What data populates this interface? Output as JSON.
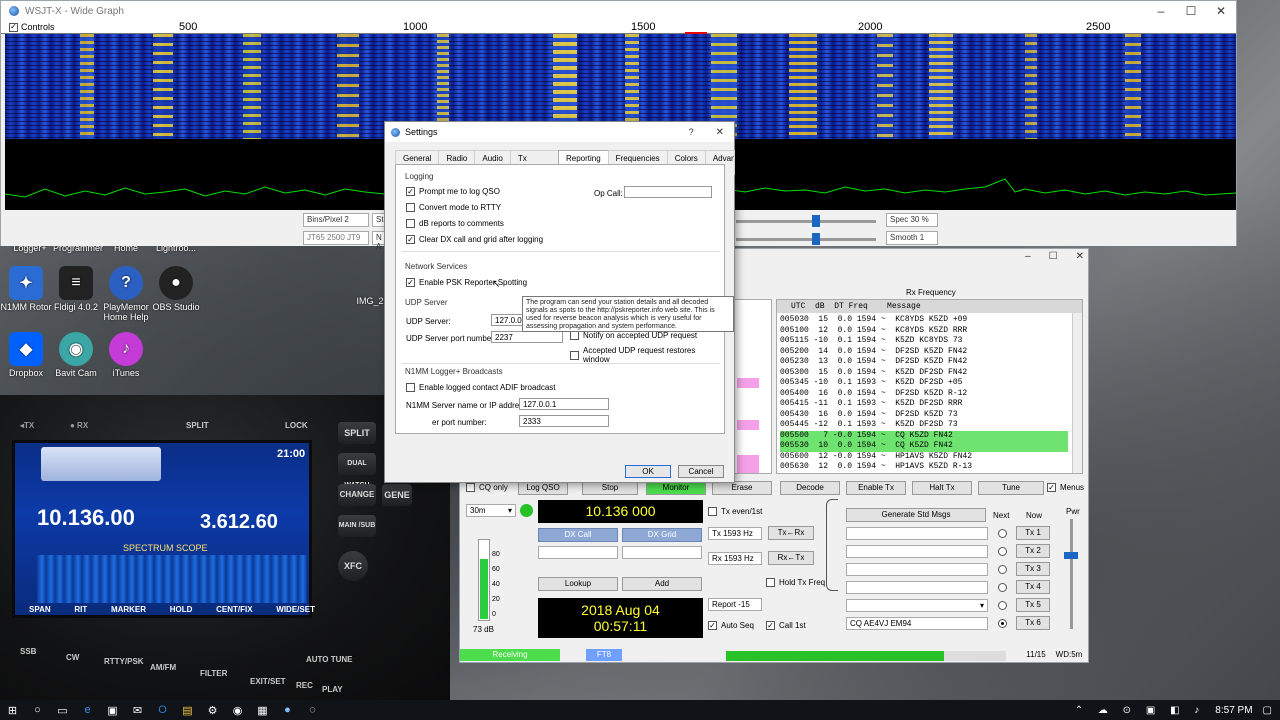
{
  "widegraph": {
    "title": "WSJT-X - Wide Graph",
    "controls_label": "Controls",
    "scale_labels": [
      "500",
      "1000",
      "1500",
      "2000",
      "2500"
    ],
    "bins_per_pixel": "Bins/Pixel  2",
    "start_label": "Sta",
    "mode_label": "JT65  2500  JT9",
    "n_avg_label": "N A",
    "spec_label": "Spec 30 %",
    "smooth_label": "Smooth  1"
  },
  "desktop": {
    "icons": [
      {
        "label": "Logger+",
        "glyph": "L",
        "color": "#3a6fb0"
      },
      {
        "label": "Programmer",
        "glyph": "P",
        "color": "#555"
      },
      {
        "label": "Home",
        "glyph": "H",
        "color": "#555"
      },
      {
        "label": "Lightroo...",
        "glyph": "Lr",
        "color": "#2c3b55"
      },
      {
        "label": "N1MM Rotor",
        "glyph": "N",
        "color": "#2b6cd4"
      },
      {
        "label": "Fldigi 4.0.2",
        "glyph": "F",
        "color": "#222"
      },
      {
        "label": "PlayMemor Home Help",
        "glyph": "?",
        "color": "#2b5fc2"
      },
      {
        "label": "OBS Studio",
        "glyph": "●",
        "color": "#222"
      },
      {
        "label": "Dropbox",
        "glyph": "◆",
        "color": "#0061ff"
      },
      {
        "label": "Bavit Cam",
        "glyph": "◉",
        "color": "#3aa6a6"
      },
      {
        "label": "iTunes",
        "glyph": "♪",
        "color": "#c43bd8"
      },
      {
        "label": "IMG_2",
        "glyph": "▣",
        "color": "#666"
      }
    ]
  },
  "settings": {
    "title": "Settings",
    "help": "?",
    "close": "✕",
    "tabs": [
      "General",
      "Radio",
      "Audio",
      "Tx Macros",
      "Reporting",
      "Frequencies",
      "Colors",
      "Advanced"
    ],
    "logging_label": "Logging",
    "prompt_log": "Prompt me to log QSO",
    "convert_rtty": "Convert mode to RTTY",
    "db_reports": "dB reports to comments",
    "clear_dx": "Clear DX call and grid after logging",
    "op_call_label": "Op Call:",
    "network_label": "Network Services",
    "psk_reporter": "Enable PSK Reporter Spotting",
    "udp_label": "UDP Server",
    "udp_server_label": "UDP Server:",
    "udp_server_value": "127.0.0.",
    "udp_port_label": "UDP Server port number:",
    "udp_port_value": "2237",
    "notify_udp": "Notify on accepted UDP request",
    "accepted_udp": "Accepted UDP request restores window",
    "n1mm_label": "N1MM Logger+ Broadcasts",
    "enable_adif": "Enable logged contact ADIF broadcast",
    "n1mm_server_label": "N1MM Server name or IP address:",
    "n1mm_server_value": "127.0.0.1",
    "n1mm_port_label": "er port number:",
    "n1mm_port_value": "2333",
    "tooltip": "The program can send your station details and all decoded signals as spots to the http://pskreporter.info web site. This is used for reverse beacon analysis which is very useful for assessing propagation and system performance.",
    "ok": "OK",
    "cancel": "Cancel"
  },
  "main": {
    "rx_frequency_title": "Rx Frequency",
    "decode_header": "UTC  dB  DT Freq    Message",
    "decodes": [
      "005030  15  0.0 1594 ~  KC8YDS K5ZD +09",
      "005100  12  0.0 1594 ~  KC8YDS K5ZD RRR",
      "005115 -10  0.1 1594 ~  K5ZD KC8YDS 73",
      "005200  14  0.0 1594 ~  DF2SD K5ZD FN42",
      "005230  13  0.0 1594 ~  DF2SD K5ZD FN42",
      "005300  15  0.0 1594 ~  K5ZD DF2SD FN42",
      "005345 -10  0.1 1593 ~  K5ZD DF2SD +05",
      "005400  16  0.0 1594 ~  DF2SD K5ZD R-12",
      "005415 -11  0.1 1593 ~  K5ZD DF2SD RRR",
      "005430  16  0.0 1594 ~  DF2SD K5ZD 73",
      "005445 -12  0.1 1593 ~  K5ZD DF2SD 73",
      "005500   7 -0.0 1594 ~  CQ K5ZD FN42",
      "005530  10  0.0 1594 ~  CQ K5ZD FN42",
      "005600  12 -0.0 1594 ~  HP1AVS K5ZD FN42",
      "005630  12  0.0 1594 ~  HP1AVS K5ZD R-13"
    ],
    "toolbar": [
      "CQ only",
      "Log QSO",
      "Stop",
      "Monitor",
      "Erase",
      "Decode",
      "Enable Tx",
      "Halt Tx",
      "Tune"
    ],
    "menus_label": "Menus",
    "band": "30m",
    "dial_freq": "10.136 000",
    "tx_even": "Tx even/1st",
    "dx_call": "DX Call",
    "dx_grid": "DX Grid",
    "tx_freq": "Tx  1593 Hz",
    "rx_freq": "Rx  1593 Hz",
    "tx_to_rx": "Tx←Rx",
    "rx_to_tx": "Rx←Tx",
    "lookup": "Lookup",
    "add": "Add",
    "hold_tx": "Hold Tx Freq",
    "date": "2018 Aug 04",
    "time": "00:57:11",
    "report": "Report -15",
    "auto_seq": "Auto Seq",
    "call_1st": "Call 1st",
    "db_level": "73 dB",
    "meter_ticks": [
      "80",
      "60",
      "40",
      "20",
      "0"
    ],
    "next_label": "Next",
    "now_label": "Now",
    "gen_std": "Generate Std Msgs",
    "pwr": "Pwr",
    "tx6_msg": "CQ AE4VJ EM94",
    "tx_buttons": [
      "Tx 1",
      "Tx 2",
      "Tx 3",
      "Tx 4",
      "Tx 5",
      "Tx 6"
    ],
    "status_receiving": "Receiving",
    "status_mode": "FT8",
    "status_count": "11/15",
    "status_wd": "WD:5m"
  },
  "radio": {
    "split": "SPLIT",
    "lock": "LOCK",
    "freq_main": "10.136.00",
    "freq_sub": "3.612.60",
    "clock": "21:00",
    "spectrum_label": "SPECTRUM SCOPE",
    "keys": [
      "SPLIT",
      "DUAL WATCH",
      "CHANGE",
      "MAIN /SUB",
      "XFC",
      "GENE",
      "AUTO TUNE",
      "FILTER",
      "EXIT/SET",
      "REC",
      "PLAY",
      "SSB",
      "CW",
      "RTTY/PSK",
      "AM/FM"
    ],
    "softkeys": [
      "SPAN",
      "RIT",
      "MARKER",
      "HOLD",
      "CENT/FIX",
      "WIDE/SET"
    ]
  },
  "taskbar": {
    "time": "8:57 PM"
  },
  "colors": {
    "decode_highlight": "#6fe36f",
    "waterfall_base": "#0b2090",
    "lcd_text": "#ffff33",
    "status_green": "#4cdd4c",
    "status_blue": "#6fa0ff"
  }
}
